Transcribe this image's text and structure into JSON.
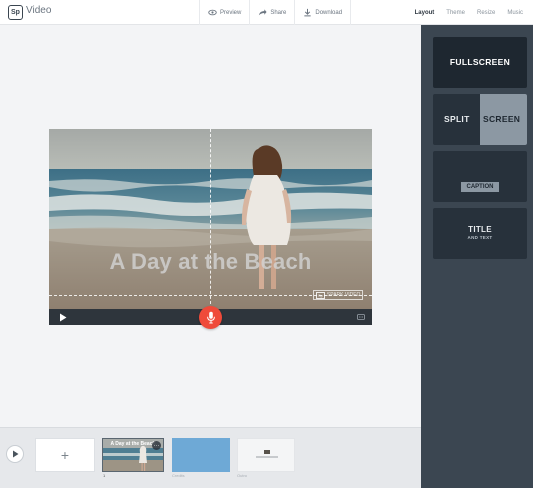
{
  "app": {
    "logo_mark": "Sp",
    "name": "Video"
  },
  "header": {
    "actions": [
      {
        "label": "Preview",
        "icon": "eye-icon"
      },
      {
        "label": "Share",
        "icon": "share-icon"
      },
      {
        "label": "Download",
        "icon": "download-icon"
      }
    ],
    "tabs": [
      {
        "label": "Layout",
        "active": true
      },
      {
        "label": "Theme",
        "active": false
      },
      {
        "label": "Resize",
        "active": false
      },
      {
        "label": "Music",
        "active": false
      }
    ]
  },
  "layouts": {
    "fullscreen": "FULLSCREEN",
    "split_left": "SPLIT",
    "split_right": "SCREEN",
    "caption": "CAPTION",
    "title": "TITLE",
    "title_sub": "AND TEXT"
  },
  "video": {
    "title": "A Day at the Beach",
    "watermark_logo": "Sp",
    "watermark_text": "SPARK VIDEO"
  },
  "timeline": {
    "add_label": "+",
    "clips": [
      {
        "title": "A Day at the Beach",
        "number": "1",
        "sublabel": ""
      },
      {
        "title": "",
        "number": "",
        "sublabel": "Credits"
      },
      {
        "title": "",
        "number": "",
        "sublabel": "Outro"
      }
    ]
  },
  "colors": {
    "accent_mic": "#ef4a3a",
    "panel_bg": "#3b4651",
    "card_bg": "#27313b",
    "clip_blue": "#6ea9d6"
  }
}
